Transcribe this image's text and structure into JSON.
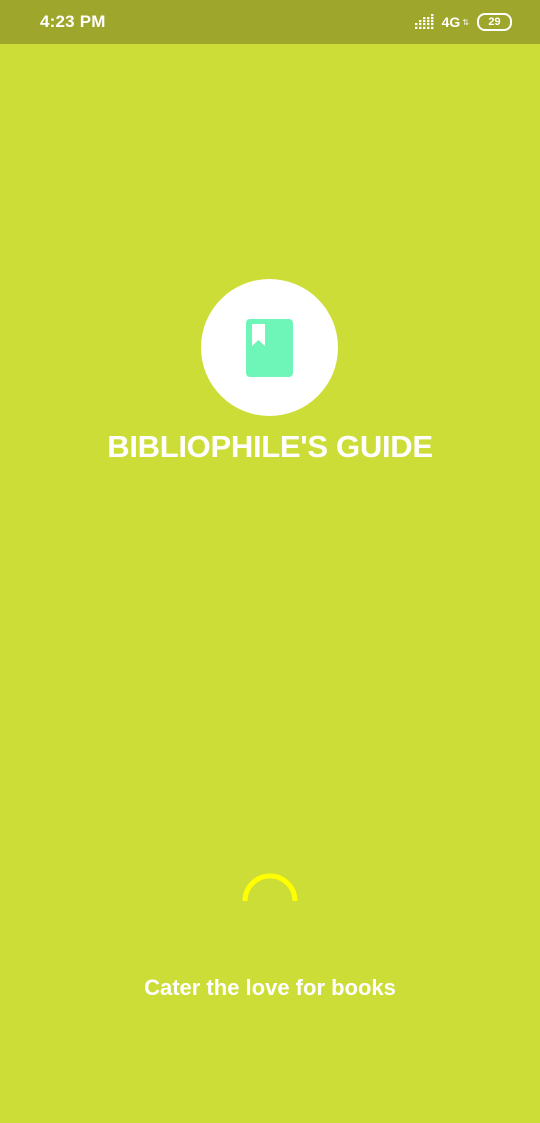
{
  "status_bar": {
    "time": "4:23 PM",
    "network": "4G",
    "battery_level": "29",
    "icons": [
      "signal-strength-icon",
      "data-arrows-icon",
      "battery-icon"
    ]
  },
  "splash": {
    "logo_icon": "book-bookmark-icon",
    "title": "BIBLIOPHILE'S GUIDE",
    "tagline": "Cater the love for books",
    "loading_indicator": "spinner"
  },
  "colors": {
    "background": "#cddd38",
    "status_bar": "#9ea62c",
    "book_icon": "#6ef6b8",
    "spinner": "#ffff00",
    "text": "#ffffff"
  }
}
